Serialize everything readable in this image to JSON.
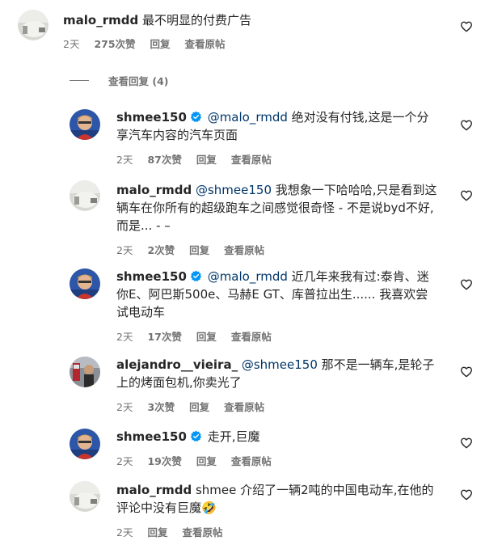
{
  "top_comment": {
    "username": "malo_rmdd",
    "text": "最不明显的付费广告",
    "time": "2天",
    "likes": "275次赞",
    "reply": "回复",
    "view_post": "查看原帖"
  },
  "view_replies": "查看回复 (4)",
  "replies": [
    {
      "username": "shmee150",
      "verified": true,
      "mention": "@malo_rmdd",
      "text": " 绝对没有付钱,这是一个分享汽车内容的汽车页面",
      "time": "2天",
      "likes": "87次赞",
      "reply": "回复",
      "view_post": "查看原帖"
    },
    {
      "username": "malo_rmdd",
      "verified": false,
      "mention": "@shmee150",
      "text": " 我想象一下哈哈哈,只是看到这辆车在你所有的超级跑车之间感觉很奇怪 - 不是说byd不好,而是... - –",
      "time": "2天",
      "likes": "2次赞",
      "reply": "回复",
      "view_post": "查看原帖"
    },
    {
      "username": "shmee150",
      "verified": true,
      "mention": "@malo_rmdd",
      "text": " 近几年来我有过:泰肯、迷你E、阿巴斯500e、马赫E GT、库普拉出生...... 我喜欢尝试电动车",
      "time": "2天",
      "likes": "17次赞",
      "reply": "回复",
      "view_post": "查看原帖"
    },
    {
      "username": "alejandro__vieira_",
      "verified": false,
      "mention": "@shmee150",
      "text": " 那不是一辆车,是轮子上的烤面包机,你卖光了",
      "time": "2天",
      "likes": "3次赞",
      "reply": "回复",
      "view_post": "查看原帖"
    },
    {
      "username": "shmee150",
      "verified": true,
      "mention": "",
      "text": "走开,巨魔",
      "time": "2天",
      "likes": "19次赞",
      "reply": "回复",
      "view_post": "查看原帖"
    },
    {
      "username": "malo_rmdd",
      "verified": false,
      "mention": "",
      "text": "shmee 介绍了一辆2吨的中国电动车,在他的评论中没有巨魔🤣",
      "time": "2天",
      "likes": "",
      "reply": "回复",
      "view_post": "查看原帖"
    }
  ],
  "colors": {
    "verified": "#0095f6",
    "mention": "#00376b",
    "meta": "#737373"
  }
}
